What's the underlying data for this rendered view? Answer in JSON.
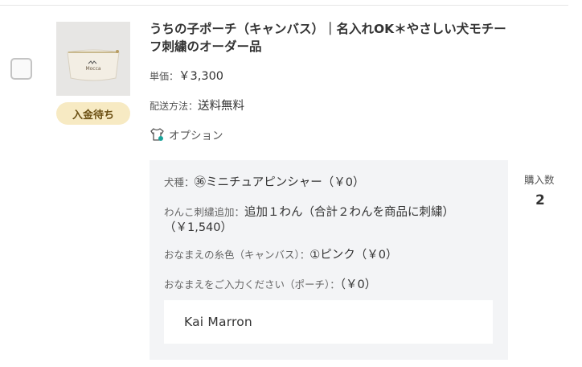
{
  "item": {
    "title": "うちの子ポーチ（キャンバス）｜名入れOK＊やさしい犬モチーフ刺繍のオーダー品",
    "status_badge": "入金待ち",
    "price_label": "単価：",
    "price_value": "￥3,300",
    "shipping_label": "配送方法：",
    "shipping_value": "送料無料",
    "option_toggle_label": "オプション",
    "option_icon": "shirt-icon",
    "thumbnail_text": "Mocca"
  },
  "options": [
    {
      "label": "犬種：",
      "value": "㊱ミニチュアピンシャー（￥0）"
    },
    {
      "label": "わんこ刺繍追加：",
      "value": "追加１わん（合計２わんを商品に刺繍）（￥1,540）"
    },
    {
      "label": "おなまえの糸色（キャンバス）：",
      "value": "①ピンク（￥0）"
    },
    {
      "label": "おなまえをご入力ください（ポーチ）：",
      "value": "（￥0）"
    }
  ],
  "name_input_value": "Kai Marron",
  "quantity": {
    "label": "購入数",
    "value": "2"
  },
  "colors": {
    "badge_bg": "#f7eac3",
    "panel_bg": "#f3f4f6",
    "accent_teal": "#1aa39a"
  }
}
